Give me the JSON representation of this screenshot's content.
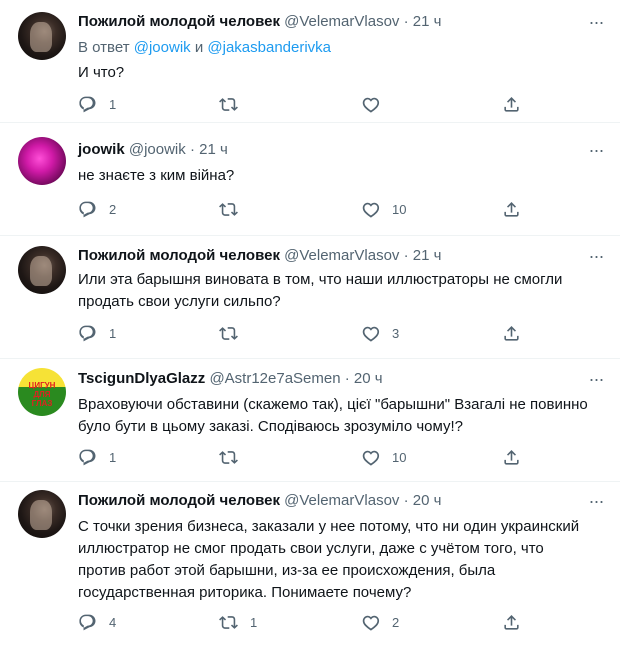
{
  "tweets": [
    {
      "name": "Пожилой молодой человек",
      "handle": "@VelemarVlasov",
      "time": "· 21 ч",
      "reply_prefix": "В ответ ",
      "reply_user1": "@joowik",
      "reply_and": " и ",
      "reply_user2": "@jakasbanderivka",
      "text": "И что?",
      "replies": "1",
      "retweets": "",
      "likes": "",
      "avatar": "dark-portrait"
    },
    {
      "name": "joowik",
      "handle": "@joowik",
      "time": "· 21 ч",
      "text": "не знаєте з ким війна?",
      "replies": "2",
      "retweets": "",
      "likes": "10",
      "avatar": "pink-neon"
    },
    {
      "name": "Пожилой молодой человек",
      "handle": "@VelemarVlasov",
      "time": "· 21 ч",
      "text": "Или эта барышня виновата в том, что наши иллюстраторы не смогли продать свои услуги сильпо?",
      "replies": "1",
      "retweets": "",
      "likes": "3",
      "avatar": "dark-portrait"
    },
    {
      "name": "TscigunDlyaGlazz",
      "handle": "@Astr12e7aSemen",
      "time": "· 20 ч",
      "text": "Враховуючи обставини (скажемо так), цієї \"барышни\" Взагалі не повинно було бути в цьому заказі. Сподіваюсь зрозуміло чому!?",
      "replies": "1",
      "retweets": "",
      "likes": "10",
      "avatar": "green-yellow-poster",
      "avatar_text": "ЦИГУН ДЛЯ ГЛАЗ"
    },
    {
      "name": "Пожилой молодой человек",
      "handle": "@VelemarVlasov",
      "time": "· 20 ч",
      "text": "С точки зрения бизнеса, заказали у нее потому, что ни один украинский иллюстратор не смог продать свои услуги, даже с учётом того, что против работ этой барышни, из-за ее происхождения, была государственная риторика. Понимаете почему?",
      "replies": "4",
      "retweets": "1",
      "likes": "2",
      "avatar": "dark-portrait"
    }
  ],
  "more_label": "···",
  "icons": {
    "reply": "reply-bubble-icon",
    "retweet": "retweet-icon",
    "like": "heart-icon",
    "share": "share-icon",
    "more": "more-dots-icon"
  },
  "colors": {
    "link": "#1d9bf0",
    "muted": "#536471",
    "text": "#0f1419"
  }
}
